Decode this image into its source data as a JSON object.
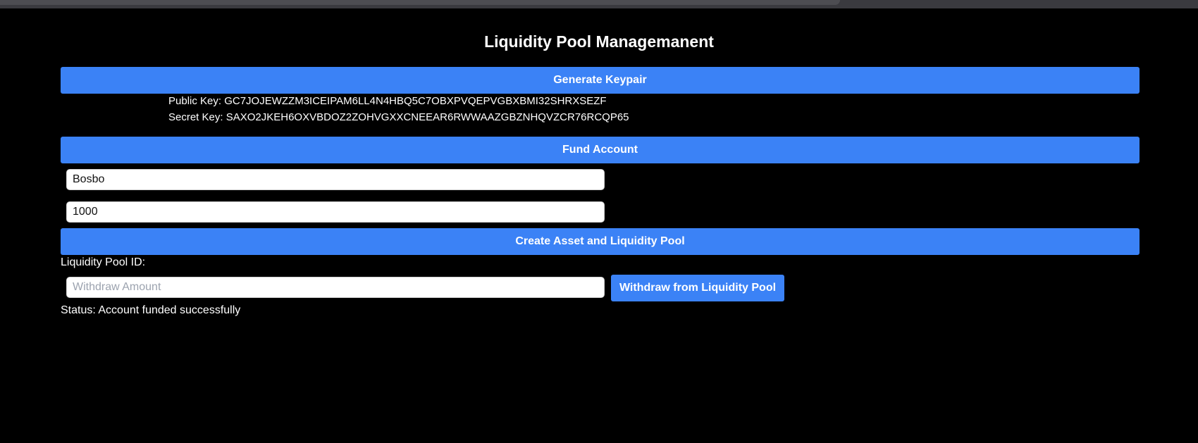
{
  "page": {
    "title": "Liquidity Pool Managemanent"
  },
  "keypair": {
    "generate_label": "Generate Keypair",
    "public_key_label": "Public Key:",
    "public_key_value": "GC7JOJEWZZM3ICEIPAM6LL4N4HBQ5C7OBXPVQEPVGBXBMI32SHRXSEZF",
    "secret_key_label": "Secret Key:",
    "secret_key_value": "SAXO2JKEH6OXVBDOZ2ZOHVGXXCNEEAR6RWWAAZGBZNHQVZCR76RCQP65"
  },
  "fund": {
    "button_label": "Fund Account",
    "asset_name_value": "Bosbo",
    "amount_value": "1000"
  },
  "pool": {
    "create_label": "Create Asset and Liquidity Pool",
    "id_label": "Liquidity Pool ID:",
    "id_value": "",
    "withdraw_placeholder": "Withdraw Amount",
    "withdraw_value": "",
    "withdraw_button_label": "Withdraw from Liquidity Pool"
  },
  "status": {
    "label": "Status:",
    "message": "Account funded successfully"
  },
  "colors": {
    "background": "#000000",
    "accent": "#3b82f6",
    "text": "#ffffff"
  }
}
